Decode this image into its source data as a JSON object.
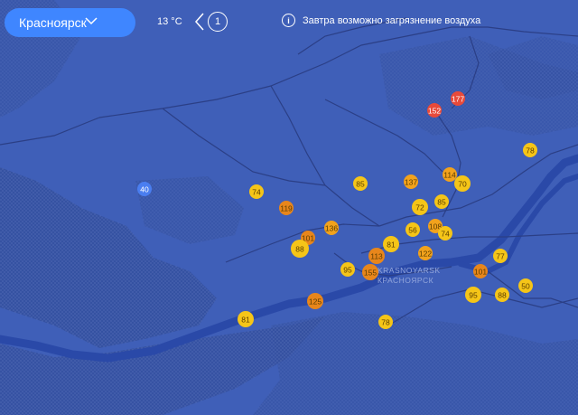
{
  "header": {
    "city": "Красноярск",
    "temperature": "13 °C",
    "page_number": "1",
    "alert_text": "Завтра возможно загрязнение воздуха"
  },
  "map": {
    "place_labels": [
      "KRASNOYARSK",
      "КРАСНОЯРСК"
    ],
    "colors": {
      "background": "#3f5fb8",
      "river": "#2c4aa6",
      "road": "#2b3f86",
      "yellow": "#f5c518",
      "orange": "#f2a21c",
      "dark_orange": "#e8861b",
      "red": "#e84a3a",
      "blue": "#4a7ef0"
    },
    "markers": [
      {
        "value": "177",
        "level": "red"
      },
      {
        "value": "152",
        "level": "red"
      },
      {
        "value": "78",
        "level": "yellow"
      },
      {
        "value": "114",
        "level": "orange"
      },
      {
        "value": "70",
        "level": "yellow"
      },
      {
        "value": "137",
        "level": "orange"
      },
      {
        "value": "85",
        "level": "yellow"
      },
      {
        "value": "85",
        "level": "yellow"
      },
      {
        "value": "72",
        "level": "yellow"
      },
      {
        "value": "40",
        "level": "blue"
      },
      {
        "value": "74",
        "level": "yellow"
      },
      {
        "value": "119",
        "level": "dark_orange"
      },
      {
        "value": "136",
        "level": "orange"
      },
      {
        "value": "108",
        "level": "orange"
      },
      {
        "value": "56",
        "level": "yellow"
      },
      {
        "value": "74",
        "level": "yellow"
      },
      {
        "value": "101",
        "level": "dark_orange"
      },
      {
        "value": "88",
        "level": "yellow"
      },
      {
        "value": "81",
        "level": "yellow"
      },
      {
        "value": "122",
        "level": "orange"
      },
      {
        "value": "113",
        "level": "dark_orange"
      },
      {
        "value": "77",
        "level": "yellow"
      },
      {
        "value": "95",
        "level": "yellow"
      },
      {
        "value": "155",
        "level": "dark_orange"
      },
      {
        "value": "101",
        "level": "dark_orange"
      },
      {
        "value": "50",
        "level": "yellow"
      },
      {
        "value": "125",
        "level": "dark_orange"
      },
      {
        "value": "95",
        "level": "yellow"
      },
      {
        "value": "88",
        "level": "yellow"
      },
      {
        "value": "81",
        "level": "yellow"
      },
      {
        "value": "78",
        "level": "yellow"
      }
    ]
  }
}
